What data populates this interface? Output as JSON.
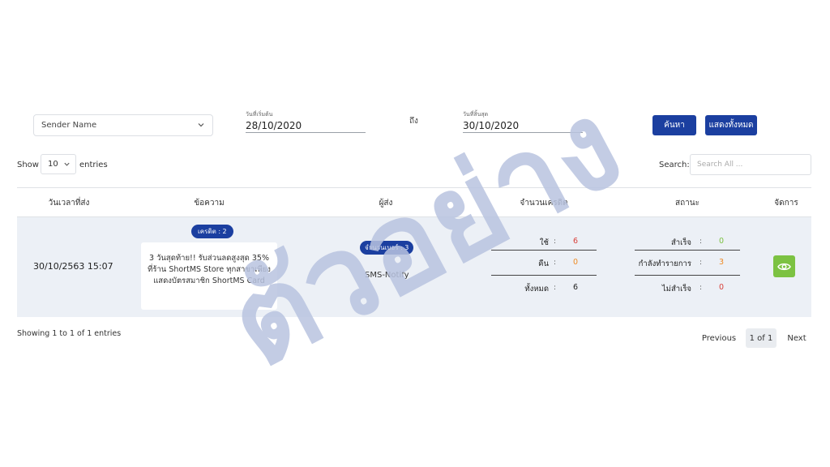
{
  "filters": {
    "sender_select": "Sender Name",
    "start_label": "วันที่เริ่มต้น",
    "start_value": "28/10/2020",
    "to_label": "ถึง",
    "end_label": "วันที่สิ้นสุด",
    "end_value": "30/10/2020",
    "search_button": "ค้นหา",
    "show_all_button": "แสดงทั้งหมด"
  },
  "table_controls": {
    "show_label": "Show",
    "entries_value": "10",
    "entries_label": "entries",
    "search_label": "Search:",
    "search_placeholder": "Search All ..."
  },
  "table": {
    "headers": [
      "วันเวลาที่ส่ง",
      "ข้อความ",
      "ผู้ส่ง",
      "จำนวนเครดิต",
      "สถานะ",
      "จัดการ"
    ],
    "row": {
      "datetime": "30/10/2563 15:07",
      "credit_badge": "เครดิต : 2",
      "message": "3 วันสุดท้าย!! รับส่วนลดสูงสุด 35% ที่ร้าน ShortMS Store ทุกสาขาเพียงแสดงบัตรสมาชิก ShortMS Card",
      "number_badge": "จำนวนเบอร์ : 3",
      "sender": "SMS-Notify",
      "credit": {
        "used_label": "ใช้",
        "used_value": "6",
        "refund_label": "คืน",
        "refund_value": "0",
        "total_label": "ทั้งหมด",
        "total_value": "6"
      },
      "status": {
        "success_label": "สำเร็จ",
        "success_value": "0",
        "processing_label": "กำลังทำรายการ",
        "processing_value": "3",
        "failed_label": "ไม่สำเร็จ",
        "failed_value": "0"
      },
      "colon": ":",
      "action_icon": "eye-icon"
    }
  },
  "footer": {
    "showing": "Showing 1 to 1 of 1 entries",
    "previous": "Previous",
    "current": "1 of 1",
    "next": "Next"
  },
  "watermark_text": "ตัวอย่าง",
  "colors": {
    "primary": "#1b3fa0",
    "row_bg": "#ecf0f6",
    "view_button": "#7cc242",
    "red": "#d9413b",
    "orange": "#ef8a24",
    "green": "#7cc242",
    "watermark": "#b9c3df"
  }
}
